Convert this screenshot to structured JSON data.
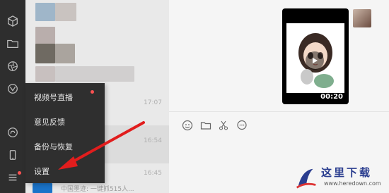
{
  "sidebar": {
    "icons": [
      "contacts-cube-icon",
      "folder-icon",
      "moments-icon",
      "channels-icon",
      "miniprogram-icon",
      "phone-icon",
      "menu-icon"
    ]
  },
  "menu": {
    "items": [
      "视频号直播",
      "意见反馈",
      "备份与恢复",
      "设置"
    ]
  },
  "chatlist": {
    "times": [
      "17:07",
      "16:54",
      "16:45"
    ],
    "bottom_text": "中国墨迹: 一键抓515人..."
  },
  "chat": {
    "video_duration": "00:20"
  },
  "toolbar": {
    "icons": [
      "emoji-icon",
      "folder-icon",
      "scissors-icon",
      "chat-bubble-icon"
    ]
  },
  "watermark": {
    "text": "这里下载",
    "url": "www.heredown.com"
  },
  "colors": {
    "accent_arrow": "#e11d1d",
    "notification_dot": "#fa5151",
    "sidebar_bg": "#2e2e2e"
  }
}
